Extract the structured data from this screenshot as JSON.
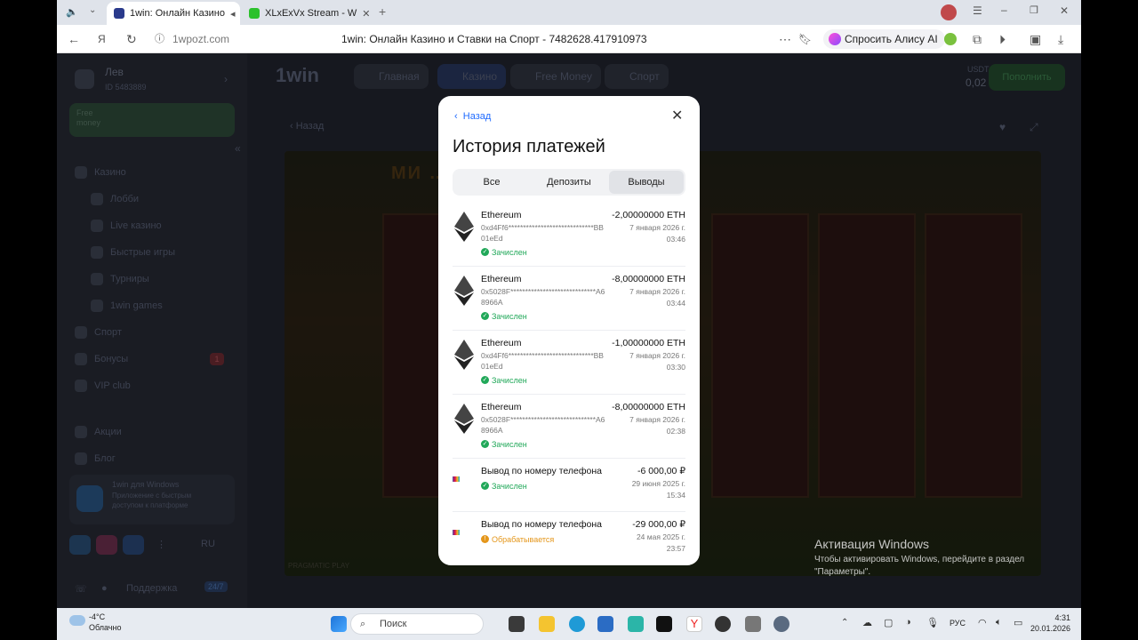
{
  "browser": {
    "tabs": [
      {
        "label": "1win: Онлайн Казино",
        "active": true
      },
      {
        "label": "XLxExVx Stream - W",
        "active": false
      }
    ],
    "url_host": "1wpozt.com",
    "page_title": "1win: Онлайн Казино и Ставки на Спорт - 7482628.417910973",
    "alice_label": "Спросить Алису AI"
  },
  "site": {
    "logo": "1win",
    "user_name": "Лев",
    "user_id": "ID 5483889",
    "free_money_promo": "Free money",
    "topnav": [
      "Главная",
      "Казино",
      "Free Money",
      "Спорт"
    ],
    "balance_currency": "USDT",
    "balance": "0,02",
    "deposit_button": "Пополнить",
    "back_label": "Назад",
    "sidebar": [
      {
        "label": "Казино"
      },
      {
        "label": "Лобби"
      },
      {
        "label": "Live казино"
      },
      {
        "label": "Быстрые игры"
      },
      {
        "label": "Турниры"
      },
      {
        "label": "1win games"
      },
      {
        "label": "Спорт"
      },
      {
        "label": "Бонусы",
        "badge": "1"
      },
      {
        "label": "VIP club"
      },
      {
        "label": "Акции"
      },
      {
        "label": "Блог"
      }
    ],
    "windows_app_title": "1win для Windows",
    "windows_app_desc": "Приложение с быстрым доступом к платформе",
    "language": "RU",
    "support": "Поддержка",
    "support_badge": "24/7",
    "game_banner": "МИ … БАРАБАНАХ 2, 3 И 4",
    "game_provider": "PRAGMATIC PLAY"
  },
  "modal": {
    "back_label": "Назад",
    "title": "История платежей",
    "tabs": [
      "Все",
      "Депозиты",
      "Выводы"
    ],
    "selected_tab": "Выводы",
    "transactions": [
      {
        "method": "Ethereum",
        "address": "0xd4Ff6*****************************BB01eEd",
        "status": "Зачислен",
        "status_kind": "ok",
        "amount": "-2,00000000 ETH",
        "date": "7 января 2026 г.",
        "time": "03:46"
      },
      {
        "method": "Ethereum",
        "address": "0x5028F*****************************A68966A",
        "status": "Зачислен",
        "status_kind": "ok",
        "amount": "-8,00000000 ETH",
        "date": "7 января 2026 г.",
        "time": "03:44"
      },
      {
        "method": "Ethereum",
        "address": "0xd4Ff6*****************************BB01eEd",
        "status": "Зачислен",
        "status_kind": "ok",
        "amount": "-1,00000000 ETH",
        "date": "7 января 2026 г.",
        "time": "03:30"
      },
      {
        "method": "Ethereum",
        "address": "0x5028F*****************************A68966A",
        "status": "Зачислен",
        "status_kind": "ok",
        "amount": "-8,00000000 ETH",
        "date": "7 января 2026 г.",
        "time": "02:38"
      },
      {
        "method": "Вывод по номеру телефона",
        "address": "",
        "status": "Зачислен",
        "status_kind": "ok",
        "amount": "-6 000,00 ₽",
        "date": "29 июня 2025 г.",
        "time": "15:34"
      },
      {
        "method": "Вывод по номеру телефона",
        "address": "",
        "status": "Обрабатывается",
        "status_kind": "pending",
        "amount": "-29 000,00 ₽",
        "date": "24 мая 2025 г.",
        "time": "23:57"
      }
    ]
  },
  "windows": {
    "activation_title": "Активация Windows",
    "activation_text": "Чтобы активировать Windows, перейдите в раздел \"Параметры\".",
    "weather_temp": "-4°C",
    "weather_desc": "Облачно",
    "search_placeholder": "Поиск",
    "lang": "РУС",
    "time": "4:31",
    "date": "20.01.2026"
  },
  "colors": {
    "accent": "#1f6bff",
    "ok": "#21a859",
    "pending": "#e4961a",
    "deposit": "#2bbd5b"
  }
}
